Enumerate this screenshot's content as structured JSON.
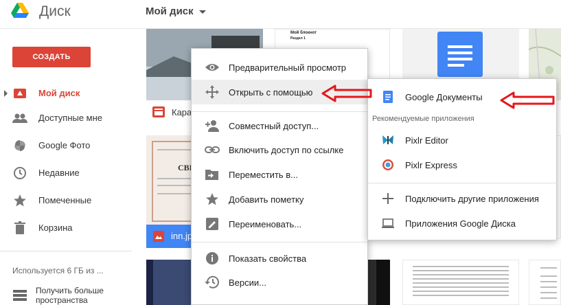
{
  "header": {
    "app_title": "Диск",
    "breadcrumb": "Мой диск",
    "icons": [
      "google-drive-logo",
      "chevron-down-icon"
    ]
  },
  "sidebar": {
    "create_label": "СОЗДАТЬ",
    "items": [
      {
        "label": "Мой диск",
        "icon": "drive-icon",
        "active": true
      },
      {
        "label": "Доступные мне",
        "icon": "people-icon"
      },
      {
        "label": "Google Фото",
        "icon": "photos-icon"
      },
      {
        "label": "Недавние",
        "icon": "clock-icon"
      },
      {
        "label": "Помеченные",
        "icon": "star-icon"
      },
      {
        "label": "Корзина",
        "icon": "trash-icon"
      }
    ],
    "storage_text": "Используется 6 ГБ из ...",
    "storage_button": "Получить больше пространства"
  },
  "files": {
    "items": [
      {
        "label": "Кара"
      },
      {
        "label": "inn.jp"
      }
    ],
    "doc_title": "Мой блокнот",
    "doc_subtitle": "Раздел 1",
    "cert_title": "СВИ"
  },
  "context_menu": {
    "items": [
      {
        "label": "Предварительный просмотр",
        "icon": "eye-icon"
      },
      {
        "label": "Открыть с помощью",
        "icon": "move-icon",
        "highlighted": true
      },
      {
        "label": "Совместный доступ...",
        "icon": "add-person-icon"
      },
      {
        "label": "Включить доступ по ссылке",
        "icon": "link-icon"
      },
      {
        "label": "Переместить в...",
        "icon": "move-to-folder-icon"
      },
      {
        "label": "Добавить пометку",
        "icon": "star-icon"
      },
      {
        "label": "Переименовать...",
        "icon": "rename-icon"
      },
      {
        "label": "Показать свойства",
        "icon": "info-icon"
      },
      {
        "label": "Версии...",
        "icon": "history-icon"
      }
    ]
  },
  "open_with_submenu": {
    "items": [
      {
        "label": "Google Документы",
        "icon": "google-docs-icon"
      },
      {
        "label": "Pixlr Editor",
        "icon": "pixlr-editor-icon"
      },
      {
        "label": "Pixlr Express",
        "icon": "pixlr-express-icon"
      },
      {
        "label": "Подключить другие приложения",
        "icon": "plus-icon"
      },
      {
        "label": "Приложения Google Диска",
        "icon": "laptop-icon"
      }
    ],
    "heading": "Рекомендуемые приложения"
  },
  "colors": {
    "accent_red": "#db4437",
    "docs_blue": "#4285f4",
    "image_file_blue": "#4285f4"
  }
}
